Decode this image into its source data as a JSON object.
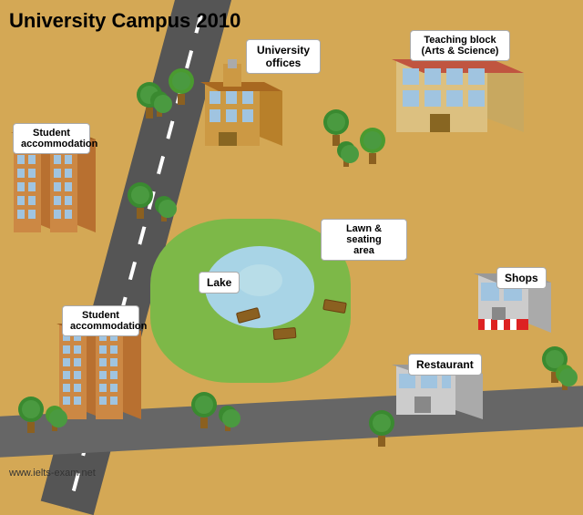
{
  "title": "University Campus 2010",
  "labels": {
    "university_offices": "University\noffices",
    "teaching_block": "Teaching block\n(Arts & Science)",
    "student_accommodation_top": "Student\naccommodation",
    "student_accommodation_bottom": "Student\naccommodation",
    "lawn_seating": "Lawn & seating\narea",
    "lake": "Lake",
    "shops": "Shops",
    "restaurant": "Restaurant"
  },
  "website": "www.ielts-exam.net",
  "colors": {
    "background": "#d4a855",
    "road": "#555555",
    "lawn": "#7db848",
    "lake": "#a8d4e6",
    "building_brick": "#cc8844",
    "building_light": "#e0aa66",
    "roof_red": "#c05540",
    "tree_dark": "#3a8a30",
    "tree_light": "#4aaa40",
    "label_bg": "#ffffff",
    "label_border": "#aaaaaa"
  }
}
